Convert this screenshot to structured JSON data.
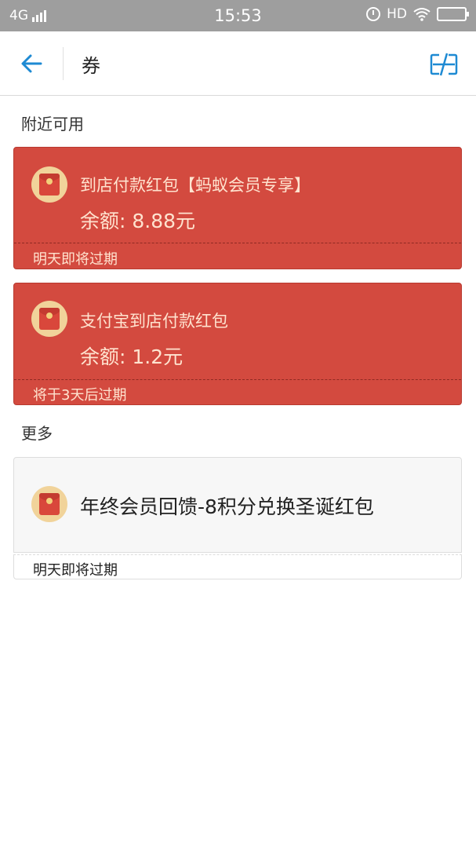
{
  "status_bar": {
    "network": "4G",
    "time": "15:53",
    "hd": "HD"
  },
  "nav": {
    "title": "券"
  },
  "sections": {
    "nearby_label": "附近可用",
    "more_label": "更多"
  },
  "nearby_coupons": [
    {
      "title": "到店付款红包【蚂蚁会员专享】",
      "amount": "余额: 8.88元",
      "expiry": "明天即将过期"
    },
    {
      "title": "支付宝到店付款红包",
      "amount": "余额: 1.2元",
      "expiry": "将于3天后过期"
    }
  ],
  "more_coupons": [
    {
      "title": "年终会员回馈-8积分兑换圣诞红包",
      "expiry": "明天即将过期"
    }
  ],
  "colors": {
    "accent": "#1e8ad3",
    "coupon_red": "#d34a3f",
    "coupon_text": "#ffe3cf",
    "status_bar": "#9e9e9e"
  },
  "icons": {
    "back": "arrow-left-icon",
    "action": "edit-icon",
    "coupon": "red-envelope-icon"
  }
}
